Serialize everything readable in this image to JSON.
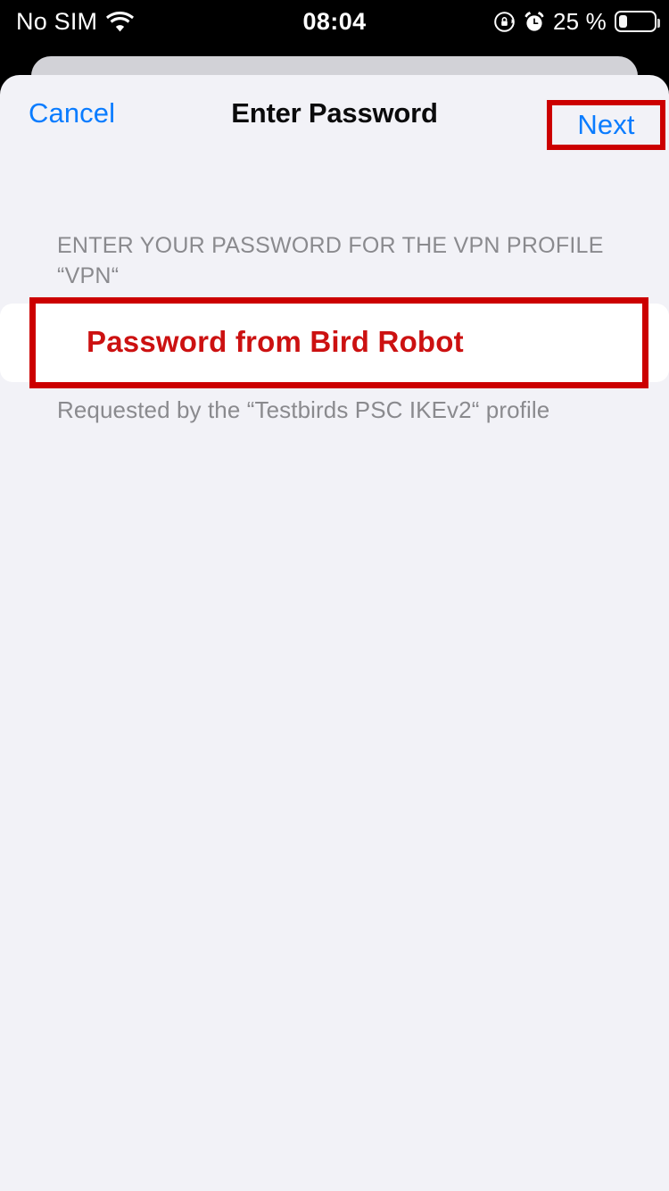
{
  "status_bar": {
    "carrier": "No SIM",
    "wifi_icon": "wifi-icon",
    "time": "08:04",
    "rotation_lock_icon": "rotation-lock-icon",
    "alarm_icon": "alarm-clock-icon",
    "battery_percent_label": "25 %",
    "battery_level": 25,
    "battery_icon": "battery-icon",
    "background_color": "#000000",
    "foreground_color": "#ffffff"
  },
  "sheet": {
    "background_color": "#f2f2f7",
    "back_card_color": "#d2d2d7",
    "corner_radius": "22px"
  },
  "nav_bar": {
    "cancel_label": "Cancel",
    "title": "Enter Password",
    "next_label": "Next",
    "tint_color": "#0a7cff",
    "title_color": "#0b0b0c"
  },
  "content": {
    "section_header": "ENTER YOUR PASSWORD FOR THE VPN PROFILE “VPN“",
    "password_field": {
      "value": "",
      "placeholder": "",
      "background_color": "#ffffff"
    },
    "footer_note": "Requested by the “Testbirds PSC IKEv2“ profile",
    "secondary_text_color": "#8a8a8e"
  },
  "annotations": {
    "highlight_color": "#cc0000",
    "field_note": "Password from Bird Robot",
    "field_note_color": "#cc1111",
    "next_button_highlight": "next-button-highlight",
    "password_field_highlight": "password-field-highlight"
  }
}
